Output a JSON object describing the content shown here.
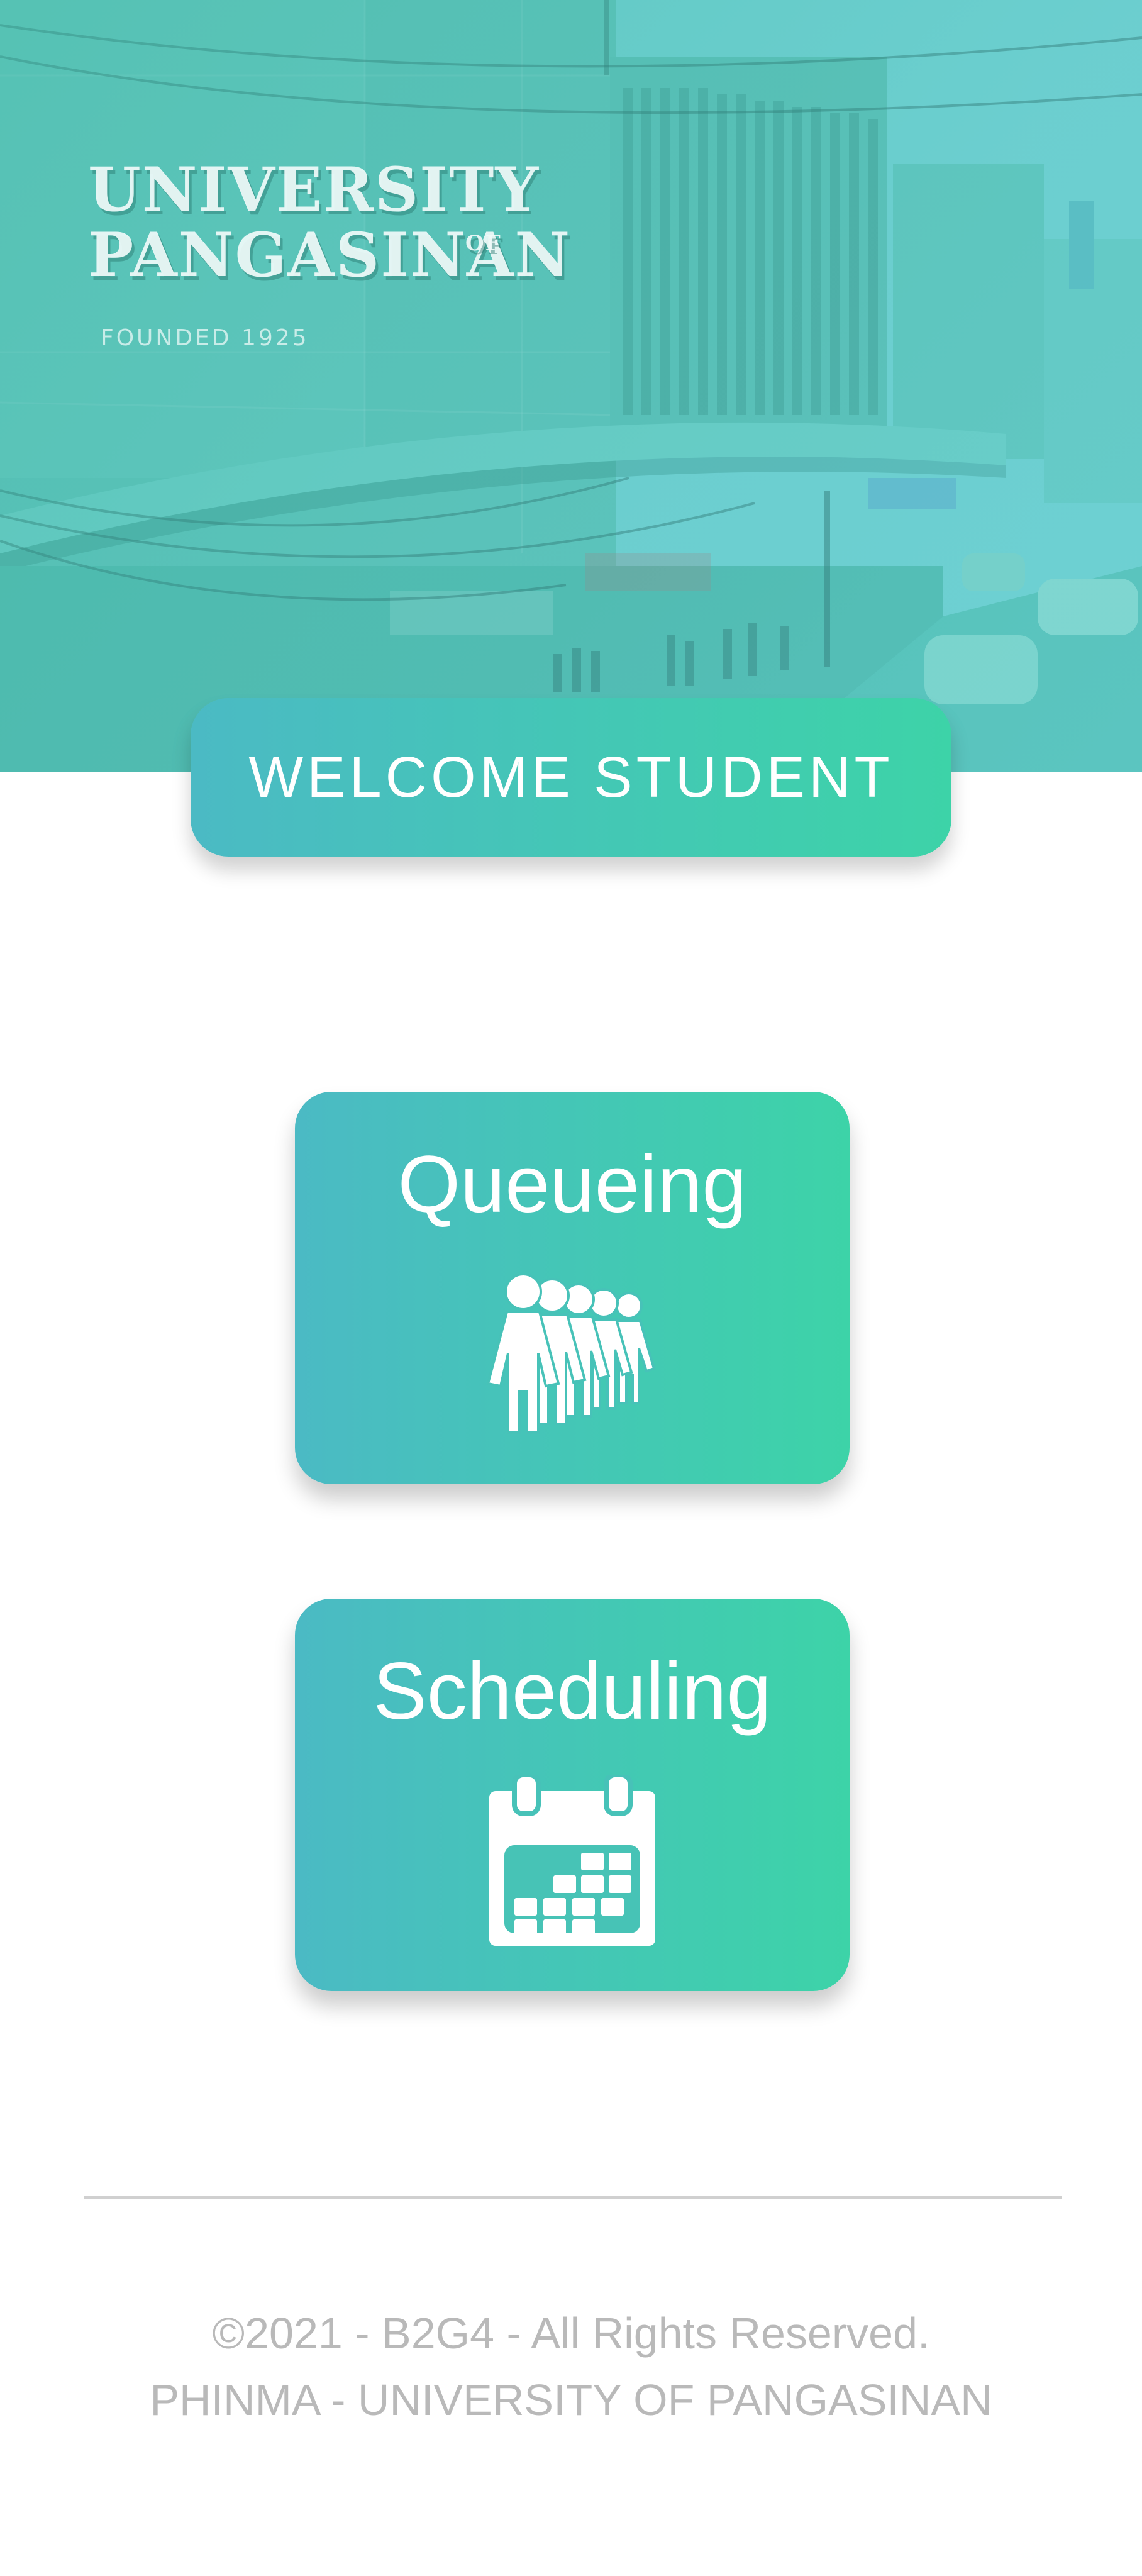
{
  "hero": {
    "sign_line1": "UNIVERSITY",
    "sign_of": "OF",
    "sign_line2": "PANGASINAN",
    "sign_founded": "FOUNDED 1925"
  },
  "welcome": {
    "label": "WELCOME STUDENT"
  },
  "menu": {
    "items": [
      {
        "label": "Queueing",
        "icon": "people-queue-icon"
      },
      {
        "label": "Scheduling",
        "icon": "calendar-icon"
      }
    ]
  },
  "footer": {
    "copyright": "©2021 - B2G4 - All Rights Reserved.",
    "institution": "PHINMA - UNIVERSITY OF PANGASINAN"
  },
  "colors": {
    "gradient_start": "#4bbac4",
    "gradient_end": "#3dd3a8",
    "footer_text": "#b9b9b9",
    "divider": "#d0d0d0"
  }
}
